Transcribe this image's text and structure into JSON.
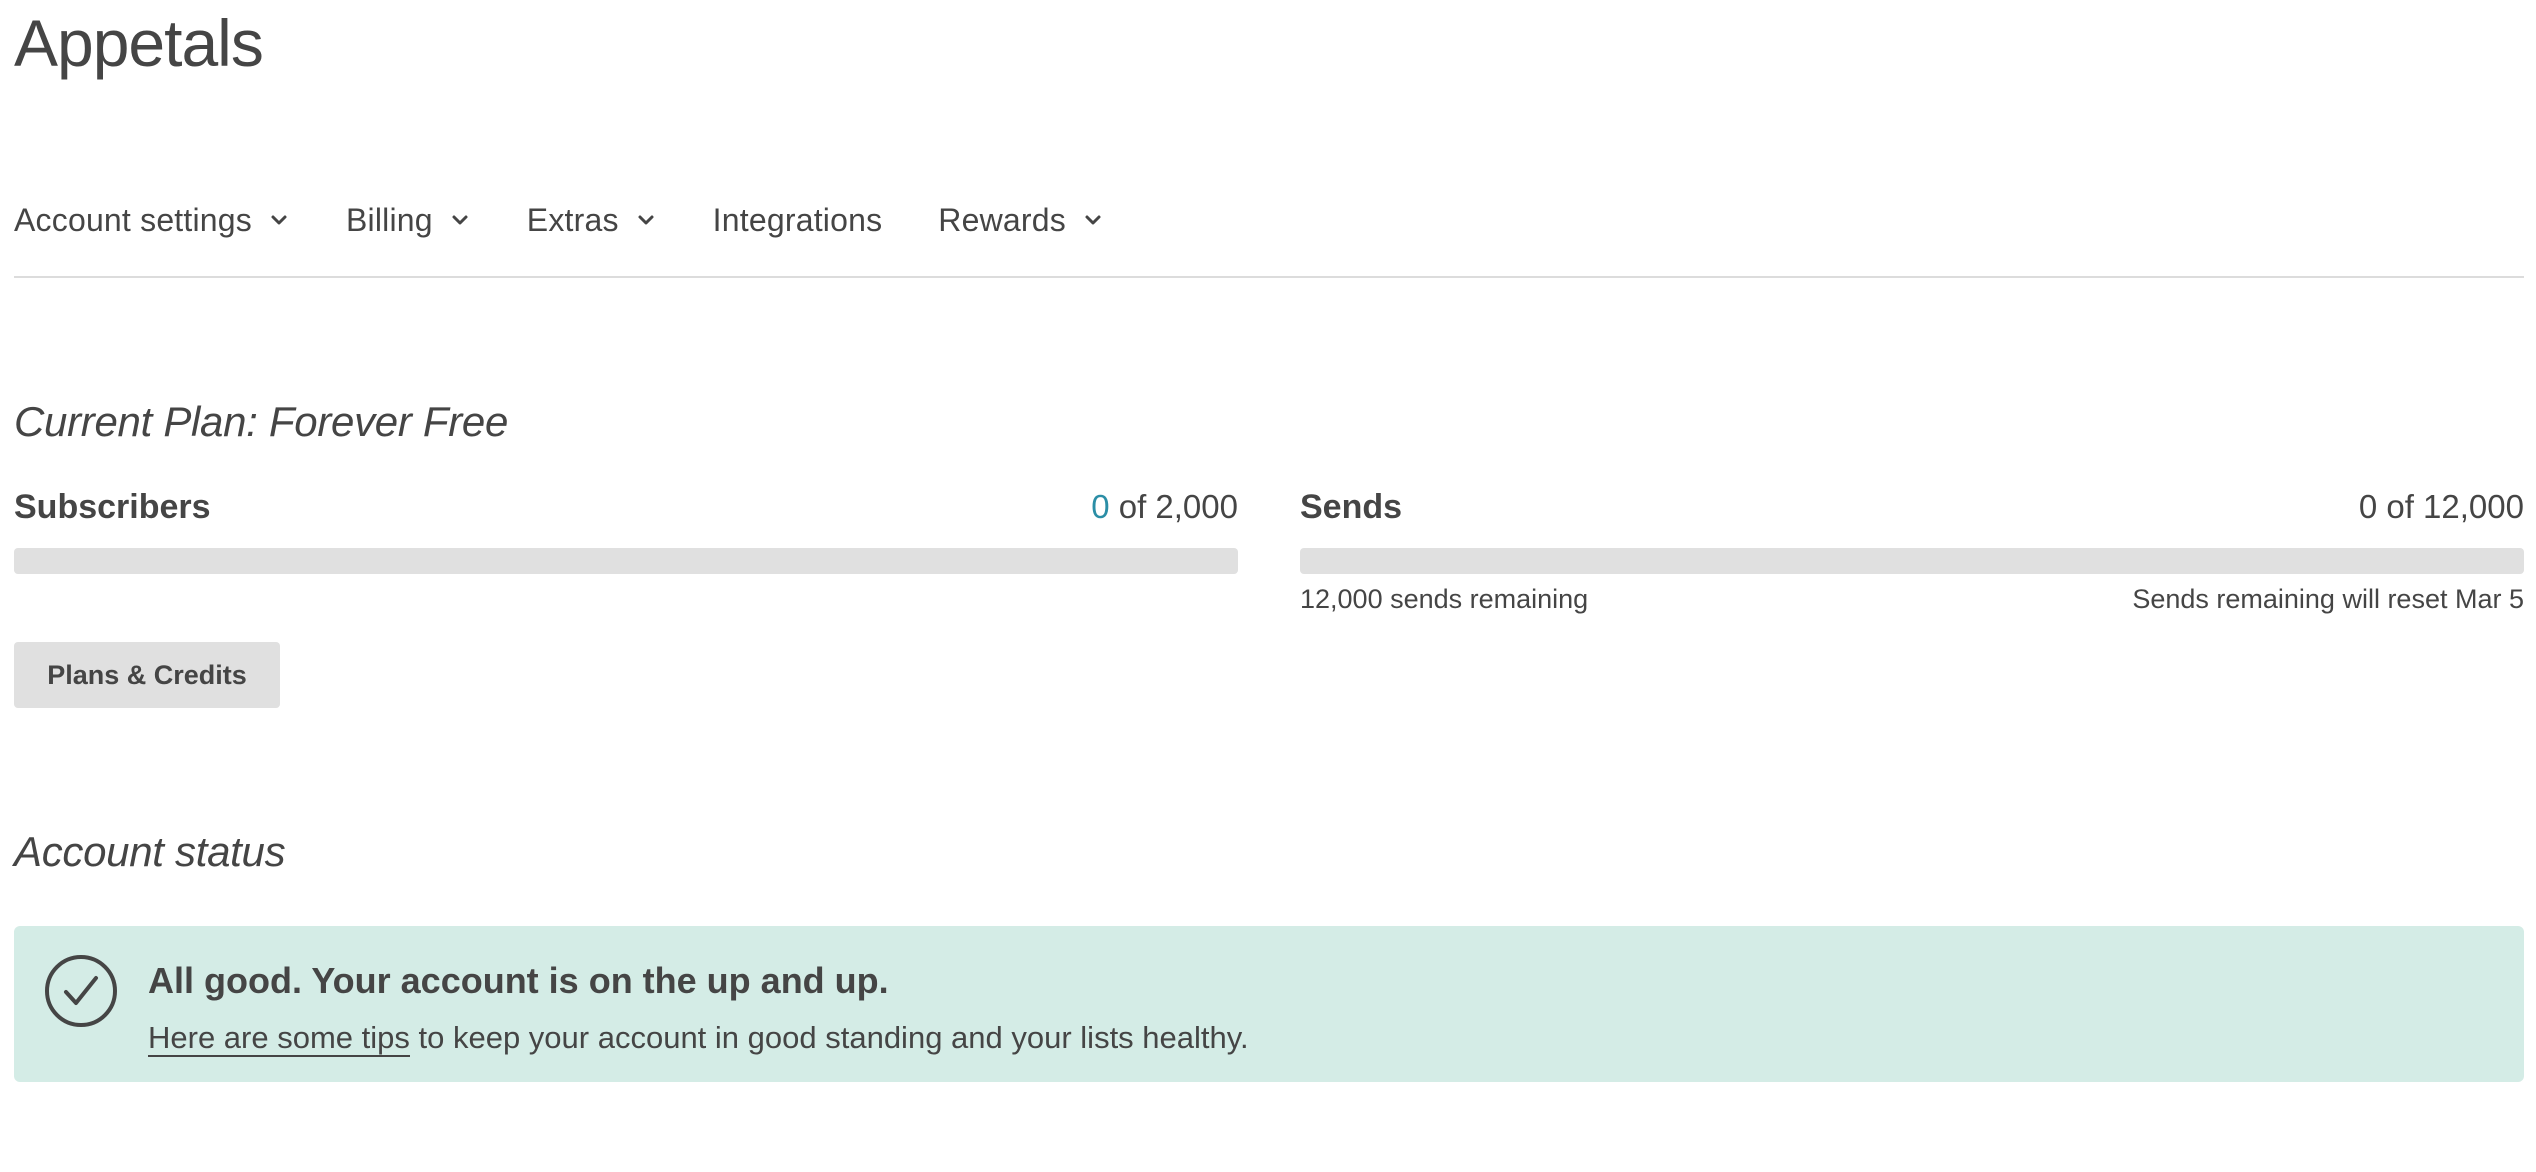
{
  "account": {
    "name": "Appetals"
  },
  "nav": {
    "tabs": [
      {
        "label": "Account settings",
        "has_dropdown": true
      },
      {
        "label": "Billing",
        "has_dropdown": true
      },
      {
        "label": "Extras",
        "has_dropdown": true
      },
      {
        "label": "Integrations",
        "has_dropdown": false
      },
      {
        "label": "Rewards",
        "has_dropdown": true
      }
    ]
  },
  "plan": {
    "title": "Current Plan: Forever Free",
    "subscribers": {
      "label": "Subscribers",
      "used": "0",
      "of_text": " of 2,000",
      "fill_fraction": 0
    },
    "sends": {
      "label": "Sends",
      "count_text": "0 of 12,000",
      "remaining_text": "12,000 sends remaining",
      "reset_text": "Sends remaining will reset Mar 5",
      "fill_fraction": 0
    },
    "plans_button_label": "Plans & Credits"
  },
  "status": {
    "title": "Account status",
    "heading": "All good. Your account is on the up and up.",
    "tips_link": "Here are some tips",
    "tips_rest": " to keep your account in good standing and your lists healthy."
  },
  "colors": {
    "text": "#454545",
    "accent": "#2b8ea6",
    "status_bg": "#d4ece6",
    "bar_bg": "#e0e0e0"
  },
  "icons": {
    "dropdown": "chevron-down-icon",
    "status": "check-circle-icon"
  }
}
